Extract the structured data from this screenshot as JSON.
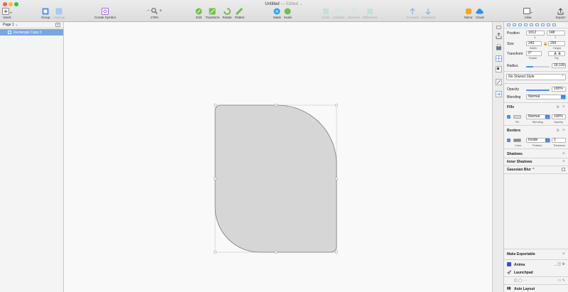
{
  "window": {
    "title": "Untitled",
    "edited": "— Edited ⌄"
  },
  "toolbar": {
    "insert": "Insert",
    "group": "Group",
    "ungroup": "Ungroup",
    "create_symbol": "Create Symbol",
    "zoom_value": "170%",
    "zoom_minus": "−",
    "zoom_plus": "+",
    "edit": "Edit",
    "transform": "Transform",
    "rotate": "Rotate",
    "flatten": "Flatten",
    "mask": "Mask",
    "scale": "Scale",
    "union": "Union",
    "subtract": "Subtract",
    "intersect": "Intersect",
    "difference": "Difference",
    "forward": "Forward",
    "backward": "Backward",
    "mirror": "Mirror",
    "cloud": "Cloud",
    "view": "View",
    "export": "Export"
  },
  "layers": {
    "page": "Page 1 ⌄",
    "add": "+",
    "items": [
      {
        "label": "Rectangle Copy 3"
      }
    ]
  },
  "inspector": {
    "position": {
      "label": "Position",
      "x": "1012",
      "y": "148",
      "x_label": "X",
      "y_label": "Y"
    },
    "size": {
      "label": "Size",
      "width": "243",
      "height": "293",
      "width_label": "Width",
      "height_label": "Height"
    },
    "transform": {
      "label": "Transform",
      "rotate": "0°",
      "rotate_label": "Rotate",
      "flip_label": "Flip"
    },
    "radius": {
      "label": "Radius",
      "value": "18;100;",
      "level": 0.3
    },
    "shared_style": "No Shared Style",
    "opacity": {
      "label": "Opacity",
      "value": "100%",
      "level": 1.0
    },
    "blending": {
      "label": "Blending",
      "value": "Normal"
    },
    "fills": {
      "title": "Fills",
      "blend": "Normal",
      "opacity": "100%",
      "color": "#d6d6d6",
      "fill_label": "Fill",
      "blending_label": "Blending",
      "opacity_label": "Opacity"
    },
    "borders": {
      "title": "Borders",
      "position": "Inside",
      "thickness": "1",
      "color": "#8a8a8a",
      "color_label": "Color",
      "position_label": "Position",
      "thickness_label": "Thickness"
    },
    "shadows": "Shadows",
    "inner_shadows": "Inner Shadows",
    "gaussian_blur": "Gaussian Blur ⌃",
    "make_exportable": "Make Exportable",
    "anima": "Anima",
    "launchpad": "Launchpad",
    "auto_layout": "Auto Layout"
  },
  "colors": {
    "accent": "#3b82f6",
    "selection": "#77a7e2",
    "shape_fill": "#d6d6d6",
    "shape_stroke": "#7d7d7d"
  }
}
